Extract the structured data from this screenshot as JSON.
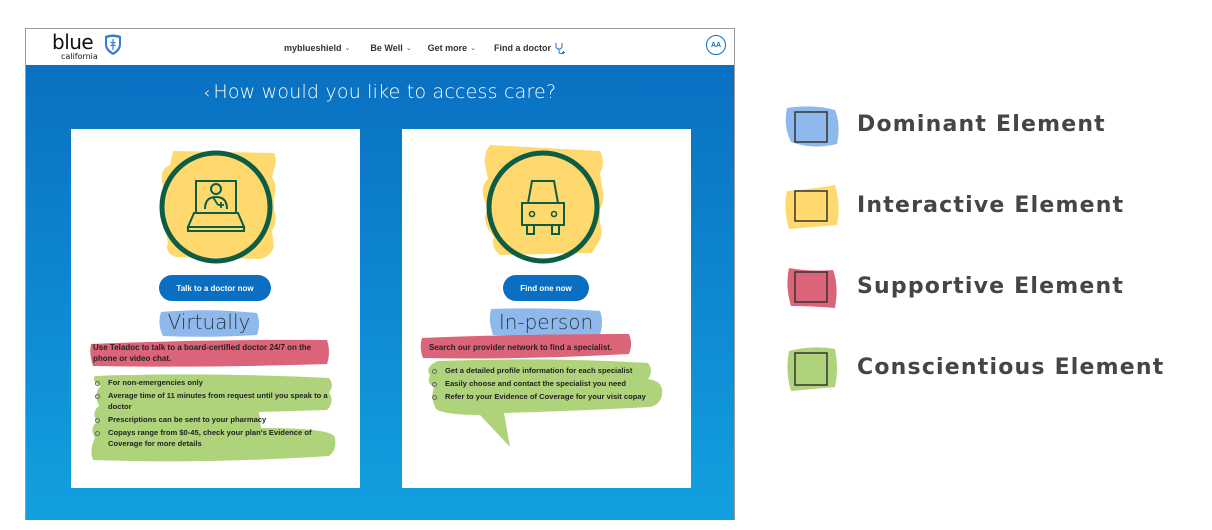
{
  "header": {
    "logo_word": "blue",
    "logo_sub": "california",
    "nav": [
      {
        "label": "myblueshield",
        "has_dropdown": true
      },
      {
        "label": "Be Well",
        "has_dropdown": true
      },
      {
        "label": "Get more",
        "has_dropdown": true
      },
      {
        "label": "Find a doctor",
        "icon": "stethoscope-icon"
      }
    ],
    "avatar_initials": "AA",
    "dropdown_glyph": "⌄"
  },
  "page": {
    "back_glyph": "‹",
    "title": "How would you like to access care?"
  },
  "cards": [
    {
      "icon": "laptop-doctor-icon",
      "button_label": "Talk to a doctor now",
      "mode_label": "Virtually",
      "description": "Use Teladoc to talk to a board-certified doctor 24/7 on the phone or video chat.",
      "bullets": [
        "For non-emergencies only",
        "Average time of 11 minutes from request until you speak to a doctor",
        "Prescriptions can be sent to your pharmacy",
        "Copays range from $0-45, check your plan's Evidence of Coverage for more details"
      ]
    },
    {
      "icon": "car-icon",
      "button_label": "Find one now",
      "mode_label": "In-person",
      "description": "Search our provider network to find a specialist.",
      "bullets": [
        "Get a detailed profile information for each specialist",
        "Easily choose and contact the specialist you need",
        "Refer to your Evidence of Coverage for your visit copay"
      ]
    }
  ],
  "legend": [
    {
      "label": "Dominant Element",
      "color": "#8fb9ec"
    },
    {
      "label": "Interactive Element",
      "color": "#ffd86e"
    },
    {
      "label": "Supportive Element",
      "color": "#dc6479"
    },
    {
      "label": "Conscientious Element",
      "color": "#aed37b"
    }
  ],
  "colors": {
    "brand_blue": "#0a6fc2",
    "icon_green": "#0d5c44",
    "heading_text": "#ffffff"
  }
}
